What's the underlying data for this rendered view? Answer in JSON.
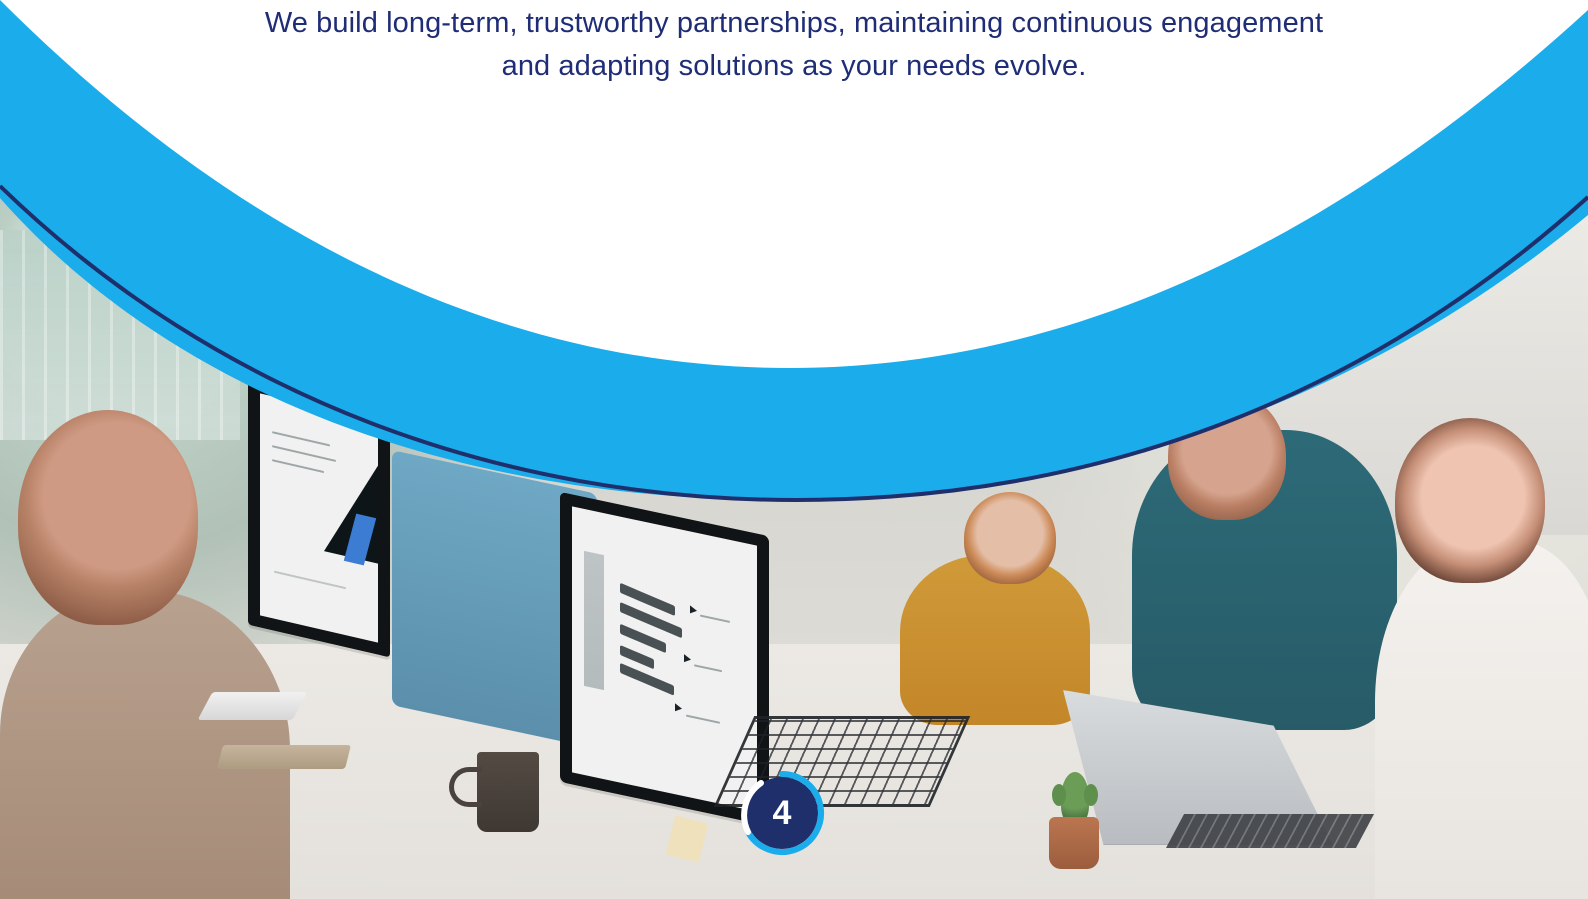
{
  "content": {
    "paragraph_lines": [
      "We build long-term, trustworthy partnerships, maintaining continuous engagement",
      "and adapting solutions as your needs evolve."
    ]
  },
  "badge": {
    "page_number": "4"
  },
  "colors": {
    "text_primary": "#1f2d76",
    "accent_blue": "#1aaceb",
    "navy_border": "#1e2f6b",
    "white": "#ffffff"
  },
  "icons": {
    "badge_ring": "page-number-ring-icon"
  }
}
